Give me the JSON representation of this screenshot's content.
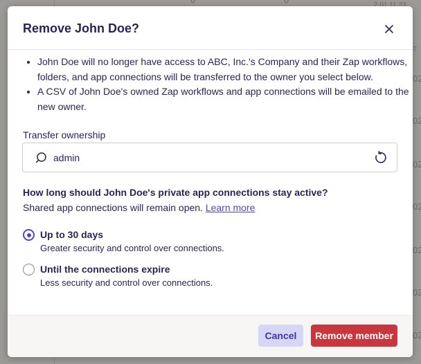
{
  "background": {
    "fragments": [
      "0",
      "0",
      "2 01 11 23",
      "T",
      "02",
      "02",
      "02",
      "02",
      "02",
      "02",
      "02"
    ]
  },
  "modal": {
    "title": "Remove John Doe?",
    "close_icon": "close-icon",
    "bullets": [
      "John Doe will no longer have access to ABC, Inc.'s Company and their Zap workflows, folders, and app connections will be transferred to the owner you select below.",
      "A CSV of John Doe's owned Zap workflows and app connections will be emailed to the new owner."
    ],
    "transfer": {
      "label": "Transfer ownership",
      "value": "admin",
      "search_icon": "search-icon",
      "reset_icon": "reset-icon"
    },
    "question": {
      "title": "How long should John Doe's private app connections stay active?",
      "subtext": "Shared app connections will remain open.",
      "link": "Learn more"
    },
    "options": [
      {
        "title": "Up to 30 days",
        "description": "Greater security and control over connections.",
        "selected": true
      },
      {
        "title": "Until the connections expire",
        "description": "Less security and control over connections.",
        "selected": false
      }
    ],
    "footer": {
      "cancel_label": "Cancel",
      "remove_label": "Remove member"
    }
  },
  "colors": {
    "text": "#2b2358",
    "accent": "#5346c7",
    "danger": "#c9373e",
    "cancel_bg": "#d8d6f7"
  }
}
